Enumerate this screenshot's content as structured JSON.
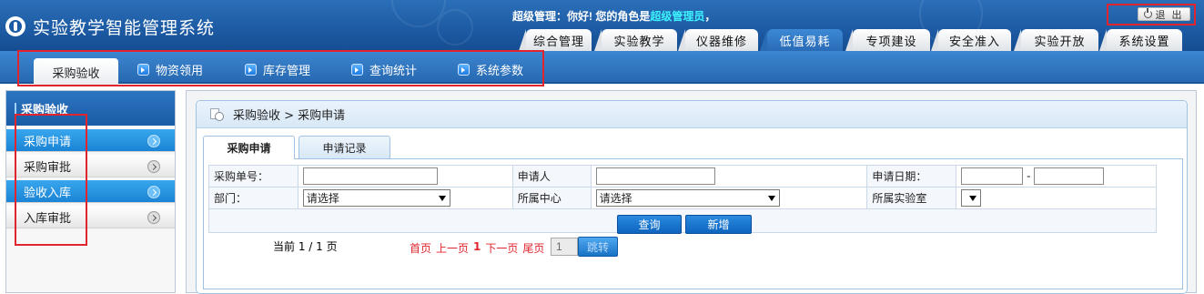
{
  "app": {
    "title": "实验教学智能管理系统"
  },
  "user": {
    "greeting_prefix": "超级管理：你好! 您的角色是",
    "role": "超级管理员",
    "greeting_suffix": "，"
  },
  "logout": {
    "label": "退 出"
  },
  "main_tabs": [
    {
      "label": "综合管理"
    },
    {
      "label": "实验教学"
    },
    {
      "label": "仪器维修"
    },
    {
      "label": "低值易耗"
    },
    {
      "label": "专项建设"
    },
    {
      "label": "安全准入"
    },
    {
      "label": "实验开放"
    },
    {
      "label": "系统设置"
    }
  ],
  "sub_tabs": [
    {
      "label": "采购验收"
    },
    {
      "label": "物资领用"
    },
    {
      "label": "库存管理"
    },
    {
      "label": "查询统计"
    },
    {
      "label": "系统参数"
    }
  ],
  "sidebar": {
    "title": "采购验收",
    "items": [
      {
        "label": "采购申请"
      },
      {
        "label": "采购审批"
      },
      {
        "label": "验收入库"
      },
      {
        "label": "入库审批"
      }
    ]
  },
  "breadcrumb": {
    "text": "采购验收 > 采购申请"
  },
  "inner_tabs": [
    {
      "label": "采购申请"
    },
    {
      "label": "申请记录"
    }
  ],
  "form": {
    "order_no_label": "采购单号：",
    "applicant_label": "申请人",
    "date_label": "申请日期：",
    "date_sep": "-",
    "dept_label": "部门：",
    "dept_value": "请选择",
    "center_label": "所属中心",
    "center_value": "请选择",
    "lab_label": "所属实验室",
    "lab_value": ""
  },
  "buttons": {
    "query": "查询",
    "add": "新增"
  },
  "pager": {
    "current": "当前 1 / 1 页",
    "first": "首页",
    "prev": "上一页",
    "page": "1",
    "next": "下一页",
    "last": "尾页",
    "input_value": "1",
    "go": "跳转"
  },
  "colors": {
    "header_blue": "#1c5aa3",
    "highlight_red": "#e0252e",
    "role_cyan": "#3cf2ff"
  }
}
